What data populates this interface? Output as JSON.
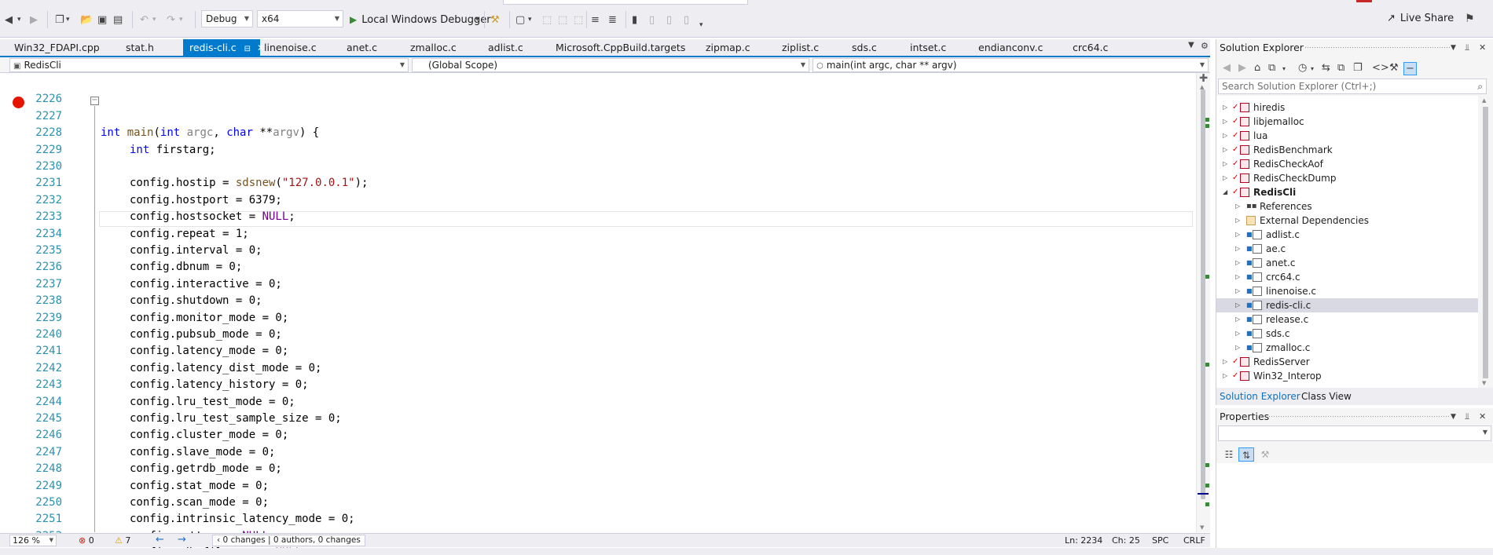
{
  "toolbar": {
    "config": "Debug",
    "platform": "x64",
    "run_label": "Local Windows Debugger",
    "live_share": "Live Share"
  },
  "tabs": [
    {
      "label": "Win32_FDAPI.cpp",
      "active": false
    },
    {
      "label": "stat.h",
      "active": false
    },
    {
      "label": "redis-cli.c",
      "active": true
    },
    {
      "label": "linenoise.c",
      "active": false
    },
    {
      "label": "anet.c",
      "active": false
    },
    {
      "label": "zmalloc.c",
      "active": false
    },
    {
      "label": "adlist.c",
      "active": false
    },
    {
      "label": "Microsoft.CppBuild.targets",
      "active": false
    },
    {
      "label": "zipmap.c",
      "active": false
    },
    {
      "label": "ziplist.c",
      "active": false
    },
    {
      "label": "sds.c",
      "active": false
    },
    {
      "label": "intset.c",
      "active": false
    },
    {
      "label": "endianconv.c",
      "active": false
    },
    {
      "label": "crc64.c",
      "active": false
    }
  ],
  "navbar": {
    "project": "RedisCli",
    "scope": "(Global Scope)",
    "member": "main(int argc, char ** argv)"
  },
  "editor": {
    "lines": [
      {
        "n": "2226",
        "code": ""
      },
      {
        "n": "2227",
        "code": "int main(int argc, char **argv) {"
      },
      {
        "n": "2228",
        "code": "int firstarg;"
      },
      {
        "n": "2229",
        "code": ""
      },
      {
        "n": "2230",
        "code": "config.hostip = sdsnew(\"127.0.0.1\");"
      },
      {
        "n": "2231",
        "code": "config.hostport = 6379;"
      },
      {
        "n": "2232",
        "code": "config.hostsocket = NULL;"
      },
      {
        "n": "2233",
        "code": "config.repeat = 1;"
      },
      {
        "n": "2234",
        "code": "config.interval = 0;"
      },
      {
        "n": "2235",
        "code": "config.dbnum = 0;"
      },
      {
        "n": "2236",
        "code": "config.interactive = 0;"
      },
      {
        "n": "2237",
        "code": "config.shutdown = 0;"
      },
      {
        "n": "2238",
        "code": "config.monitor_mode = 0;"
      },
      {
        "n": "2239",
        "code": "config.pubsub_mode = 0;"
      },
      {
        "n": "2240",
        "code": "config.latency_mode = 0;"
      },
      {
        "n": "2241",
        "code": "config.latency_dist_mode = 0;"
      },
      {
        "n": "2242",
        "code": "config.latency_history = 0;"
      },
      {
        "n": "2243",
        "code": "config.lru_test_mode = 0;"
      },
      {
        "n": "2244",
        "code": "config.lru_test_sample_size = 0;"
      },
      {
        "n": "2245",
        "code": "config.cluster_mode = 0;"
      },
      {
        "n": "2246",
        "code": "config.slave_mode = 0;"
      },
      {
        "n": "2247",
        "code": "config.getrdb_mode = 0;"
      },
      {
        "n": "2248",
        "code": "config.stat_mode = 0;"
      },
      {
        "n": "2249",
        "code": "config.scan_mode = 0;"
      },
      {
        "n": "2250",
        "code": "config.intrinsic_latency_mode = 0;"
      },
      {
        "n": "2251",
        "code": "config.pattern = NULL;"
      },
      {
        "n": "2252",
        "code": "config.rdb_filename = NULL;"
      }
    ]
  },
  "status": {
    "zoom": "126 %",
    "errors": "0",
    "warnings": "7",
    "changes": "0 changes | 0 authors, 0 changes",
    "ln": "Ln: 2234",
    "ch": "Ch: 25",
    "spc": "SPC",
    "crlf": "CRLF"
  },
  "solution_explorer": {
    "title": "Solution Explorer",
    "search_placeholder": "Search Solution Explorer (Ctrl+;)",
    "items": [
      {
        "label": "hiredis",
        "level": 0,
        "kind": "project",
        "expanded": false
      },
      {
        "label": "libjemalloc",
        "level": 0,
        "kind": "project",
        "expanded": false
      },
      {
        "label": "lua",
        "level": 0,
        "kind": "project",
        "expanded": false
      },
      {
        "label": "RedisBenchmark",
        "level": 0,
        "kind": "project",
        "expanded": false
      },
      {
        "label": "RedisCheckAof",
        "level": 0,
        "kind": "project",
        "expanded": false
      },
      {
        "label": "RedisCheckDump",
        "level": 0,
        "kind": "project",
        "expanded": false
      },
      {
        "label": "RedisCli",
        "level": 0,
        "kind": "project",
        "expanded": true,
        "bold": true
      },
      {
        "label": "References",
        "level": 1,
        "kind": "ref",
        "expanded": false
      },
      {
        "label": "External Dependencies",
        "level": 1,
        "kind": "ext",
        "expanded": false
      },
      {
        "label": "adlist.c",
        "level": 1,
        "kind": "file",
        "expanded": false
      },
      {
        "label": "ae.c",
        "level": 1,
        "kind": "file",
        "expanded": false
      },
      {
        "label": "anet.c",
        "level": 1,
        "kind": "file",
        "expanded": false
      },
      {
        "label": "crc64.c",
        "level": 1,
        "kind": "file",
        "expanded": false
      },
      {
        "label": "linenoise.c",
        "level": 1,
        "kind": "file",
        "expanded": false
      },
      {
        "label": "redis-cli.c",
        "level": 1,
        "kind": "file",
        "expanded": false,
        "selected": true
      },
      {
        "label": "release.c",
        "level": 1,
        "kind": "file",
        "expanded": false
      },
      {
        "label": "sds.c",
        "level": 1,
        "kind": "file",
        "expanded": false
      },
      {
        "label": "zmalloc.c",
        "level": 1,
        "kind": "file",
        "expanded": false
      },
      {
        "label": "RedisServer",
        "level": 0,
        "kind": "project",
        "expanded": false
      },
      {
        "label": "Win32_Interop",
        "level": 0,
        "kind": "project",
        "expanded": false
      }
    ],
    "tab_solution": "Solution Explorer",
    "tab_class": "Class View"
  },
  "properties": {
    "title": "Properties"
  },
  "colors": {
    "accent": "#007acc",
    "breakpoint": "#e51400",
    "keyword": "#0000ff",
    "string": "#a31515",
    "line_number": "#2b91af"
  }
}
